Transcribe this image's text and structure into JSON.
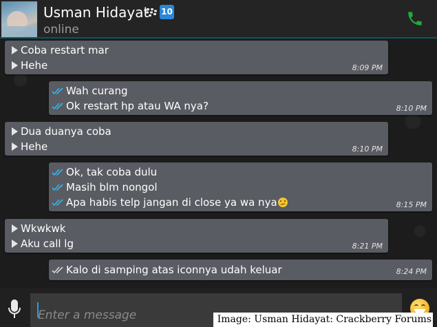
{
  "header": {
    "contact_name": "Usman Hidayat",
    "status": "online",
    "badge": "10"
  },
  "messages": [
    {
      "direction": "in",
      "lines": [
        "Coba restart mar",
        "Hehe"
      ],
      "time": "8:09 PM"
    },
    {
      "direction": "out",
      "lines": [
        "Wah curang",
        "Ok restart hp atau WA nya?"
      ],
      "time": "8:10 PM"
    },
    {
      "direction": "in",
      "lines": [
        "Dua duanya coba",
        "Hehe"
      ],
      "time": "8:10 PM"
    },
    {
      "direction": "out",
      "lines": [
        "Ok, tak coba dulu",
        "Masih blm nongol",
        "Apa habis telp jangan di close ya wa nya"
      ],
      "time": "8:15 PM",
      "emoji": "confused-face-emoji"
    },
    {
      "direction": "in",
      "lines": [
        "Wkwkwk",
        "Aku call lg"
      ],
      "time": "8:21 PM"
    },
    {
      "direction": "out",
      "lines": [
        "Kalo di samping atas iconnya udah keluar"
      ],
      "time": "8:24 PM"
    }
  ],
  "composer": {
    "placeholder": "Enter a message"
  },
  "caption": "Image: Usman Hidayat: Crackberry Forums",
  "icons": {
    "call": "phone-icon",
    "mic": "microphone-icon",
    "emoji": "smiley-icon",
    "bbm": "bbm-icon",
    "read_receipt": "double-check-icon"
  },
  "colors": {
    "accent": "#0d5562",
    "call_green": "#1faa3a",
    "tick_blue": "#34b7f1",
    "bubble": "#595c62",
    "badge_blue": "#2a86d8"
  }
}
